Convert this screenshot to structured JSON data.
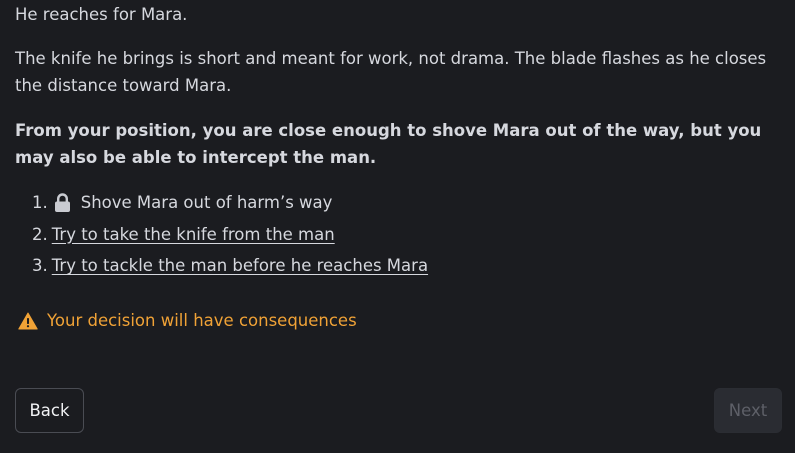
{
  "story": {
    "para1": "He reaches for Mara.",
    "para2": "The knife he brings is short and meant for work, not drama. The blade flashes as he closes the distance toward Mara.",
    "prompt": "From your position, you are close enough to shove Mara out of the way, but you may also be able to intercept the man."
  },
  "choices": [
    {
      "number": "1.",
      "label": "Shove Mara out of harm’s way",
      "locked": true,
      "icon": "lock-icon"
    },
    {
      "number": "2.",
      "label": "Try to take the knife from the man",
      "locked": false
    },
    {
      "number": "3.",
      "label": "Try to tackle the man before he reaches Mara",
      "locked": false
    }
  ],
  "warning": {
    "icon": "warning-icon",
    "text": "Your decision will have consequences",
    "color": "#f0a236"
  },
  "nav": {
    "back_label": "Back",
    "next_label": "Next",
    "next_disabled": true
  }
}
